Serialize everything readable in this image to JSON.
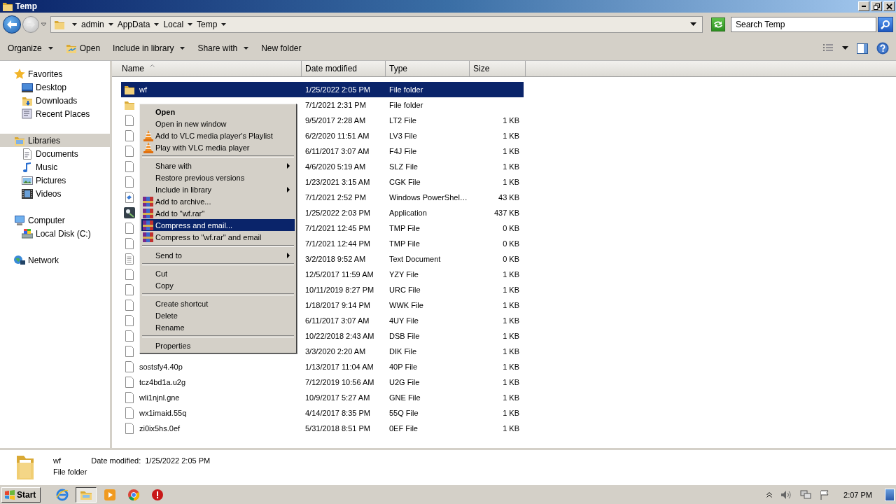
{
  "window": {
    "title": "Temp"
  },
  "address_bar": {
    "path": [
      "admin",
      "AppData",
      "Local",
      "Temp"
    ]
  },
  "search": {
    "placeholder": "Search Temp"
  },
  "toolbar": [
    {
      "label": "Organize",
      "kind": "menu"
    },
    {
      "label": "Open",
      "kind": "open"
    },
    {
      "label": "Include in library",
      "kind": "menu"
    },
    {
      "label": "Share with",
      "kind": "menu"
    },
    {
      "label": "New folder",
      "kind": "plain"
    }
  ],
  "nav_pane": [
    {
      "label": "Favorites",
      "kind": "star",
      "selected": false,
      "children": [
        {
          "label": "Desktop",
          "kind": "desktop",
          "selected": false
        },
        {
          "label": "Downloads",
          "kind": "downloads",
          "selected": false
        },
        {
          "label": "Recent Places",
          "kind": "recent",
          "selected": false
        }
      ]
    },
    {
      "label": "Libraries",
      "kind": "library",
      "selected": true,
      "children": [
        {
          "label": "Documents",
          "kind": "documents",
          "selected": false
        },
        {
          "label": "Music",
          "kind": "music",
          "selected": false
        },
        {
          "label": "Pictures",
          "kind": "pictures",
          "selected": false
        },
        {
          "label": "Videos",
          "kind": "videos",
          "selected": false
        }
      ]
    },
    {
      "label": "Computer",
      "kind": "computer",
      "selected": false,
      "children": [
        {
          "label": "Local Disk (C:)",
          "kind": "disk",
          "selected": false
        }
      ]
    },
    {
      "label": "Network",
      "kind": "network",
      "selected": false
    }
  ],
  "columns": [
    {
      "label": "Name",
      "sorted": true
    },
    {
      "label": "Date modified",
      "sorted": false
    },
    {
      "label": "Type",
      "sorted": false
    },
    {
      "label": "Size",
      "sorted": false
    }
  ],
  "rows": [
    {
      "name": "wf",
      "date": "1/25/2022 2:05 PM",
      "type": "File folder",
      "kind": "folder",
      "selected": true
    },
    {
      "date": "7/1/2021 2:31 PM",
      "type": "File folder",
      "kind": "folder",
      "selected": false
    },
    {
      "date": "9/5/2017 2:28 AM",
      "type": "LT2 File",
      "size": "1 KB",
      "kind": "file",
      "selected": false
    },
    {
      "date": "6/2/2020 11:51 AM",
      "type": "LV3 File",
      "size": "1 KB",
      "kind": "file",
      "selected": false
    },
    {
      "date": "6/11/2017 3:07 AM",
      "type": "F4J File",
      "size": "1 KB",
      "kind": "file",
      "selected": false
    },
    {
      "date": "4/6/2020 5:19 AM",
      "type": "SLZ File",
      "size": "1 KB",
      "kind": "file",
      "selected": false
    },
    {
      "date": "1/23/2021 3:15 AM",
      "type": "CGK File",
      "size": "1 KB",
      "kind": "file",
      "selected": false
    },
    {
      "date": "7/1/2021 2:52 PM",
      "type": "Windows PowerShel…",
      "size": "43 KB",
      "kind": "script",
      "selected": false
    },
    {
      "date": "1/25/2022 2:03 PM",
      "type": "Application",
      "size": "437 KB",
      "kind": "app",
      "selected": false
    },
    {
      "date": "7/1/2021 12:45 PM",
      "type": "TMP File",
      "size": "0 KB",
      "kind": "file",
      "selected": false
    },
    {
      "date": "7/1/2021 12:44 PM",
      "type": "TMP File",
      "size": "0 KB",
      "kind": "file",
      "selected": false
    },
    {
      "date": "3/2/2018 9:52 AM",
      "type": "Text Document",
      "size": "0 KB",
      "kind": "text",
      "selected": false
    },
    {
      "date": "12/5/2017 11:59 AM",
      "type": "YZY File",
      "size": "1 KB",
      "kind": "file",
      "selected": false
    },
    {
      "date": "10/11/2019 8:27 PM",
      "type": "URC File",
      "size": "1 KB",
      "kind": "file",
      "selected": false
    },
    {
      "date": "1/18/2017 9:14 PM",
      "type": "WWK File",
      "size": "1 KB",
      "kind": "file",
      "selected": false
    },
    {
      "date": "6/11/2017 3:07 AM",
      "type": "4UY File",
      "size": "1 KB",
      "kind": "file",
      "selected": false
    },
    {
      "date": "10/22/2018 2:43 AM",
      "type": "DSB File",
      "size": "1 KB",
      "kind": "file",
      "selected": false
    },
    {
      "date": "3/3/2020 2:20 AM",
      "type": "DIK File",
      "size": "1 KB",
      "kind": "file",
      "selected": false
    },
    {
      "name": "sostsfy4.40p",
      "date": "1/13/2017 11:04 AM",
      "type": "40P File",
      "size": "1 KB",
      "kind": "file",
      "selected": false
    },
    {
      "name": "tcz4bd1a.u2g",
      "date": "7/12/2019 10:56 AM",
      "type": "U2G File",
      "size": "1 KB",
      "kind": "file",
      "selected": false
    },
    {
      "name": "wli1njnl.gne",
      "date": "10/9/2017 5:27 AM",
      "type": "GNE File",
      "size": "1 KB",
      "kind": "file",
      "selected": false
    },
    {
      "name": "wx1imaid.55q",
      "date": "4/14/2017 8:35 PM",
      "type": "55Q File",
      "size": "1 KB",
      "kind": "file",
      "selected": false
    },
    {
      "name": "zi0ix5hs.0ef",
      "date": "5/31/2018 8:51 PM",
      "type": "0EF File",
      "size": "1 KB",
      "kind": "file",
      "selected": false
    }
  ],
  "context_menu": [
    {
      "kind": "plain",
      "label": "Open",
      "bold": true,
      "submenu": false,
      "selected": false
    },
    {
      "kind": "plain",
      "label": "Open in new window",
      "bold": false,
      "submenu": false,
      "selected": false
    },
    {
      "kind": "vlc",
      "label": "Add to VLC media player's Playlist",
      "bold": false,
      "submenu": false,
      "selected": false
    },
    {
      "kind": "vlc",
      "label": "Play with VLC media player",
      "bold": false,
      "submenu": false,
      "selected": false
    },
    {
      "kind": "separator"
    },
    {
      "kind": "plain",
      "label": "Share with",
      "bold": false,
      "submenu": true,
      "selected": false
    },
    {
      "kind": "plain",
      "label": "Restore previous versions",
      "bold": false,
      "submenu": false,
      "selected": false
    },
    {
      "kind": "plain",
      "label": "Include in library",
      "bold": false,
      "submenu": true,
      "selected": false
    },
    {
      "kind": "archive",
      "label": "Add to archive...",
      "bold": false,
      "submenu": false,
      "selected": false
    },
    {
      "kind": "archive",
      "label": "Add to \"wf.rar\"",
      "bold": false,
      "submenu": false,
      "selected": false
    },
    {
      "kind": "archive",
      "label": "Compress and email...",
      "bold": false,
      "submenu": false,
      "selected": true
    },
    {
      "kind": "archive",
      "label": "Compress to \"wf.rar\" and email",
      "bold": false,
      "submenu": false,
      "selected": false
    },
    {
      "kind": "separator"
    },
    {
      "kind": "plain",
      "label": "Send to",
      "bold": false,
      "submenu": true,
      "selected": false
    },
    {
      "kind": "separator"
    },
    {
      "kind": "plain",
      "label": "Cut",
      "bold": false,
      "submenu": false,
      "selected": false
    },
    {
      "kind": "plain",
      "label": "Copy",
      "bold": false,
      "submenu": false,
      "selected": false
    },
    {
      "kind": "separator"
    },
    {
      "kind": "plain",
      "label": "Create shortcut",
      "bold": false,
      "submenu": false,
      "selected": false
    },
    {
      "kind": "plain",
      "label": "Delete",
      "bold": false,
      "submenu": false,
      "selected": false
    },
    {
      "kind": "plain",
      "label": "Rename",
      "bold": false,
      "submenu": false,
      "selected": false
    },
    {
      "kind": "separator"
    },
    {
      "kind": "plain",
      "label": "Properties",
      "bold": false,
      "submenu": false,
      "selected": false
    }
  ],
  "details_pane": {
    "name": "wf",
    "date_label": "Date modified:",
    "date": "1/25/2022 2:05 PM",
    "type": "File folder"
  },
  "taskbar": {
    "start": "Start",
    "apps": [
      {
        "kind": "ie",
        "selected": false
      },
      {
        "kind": "explorer",
        "selected": true
      },
      {
        "kind": "media",
        "selected": false
      },
      {
        "kind": "chrome",
        "selected": false
      },
      {
        "kind": "stop",
        "selected": false
      }
    ],
    "clock": "2:07 PM"
  }
}
